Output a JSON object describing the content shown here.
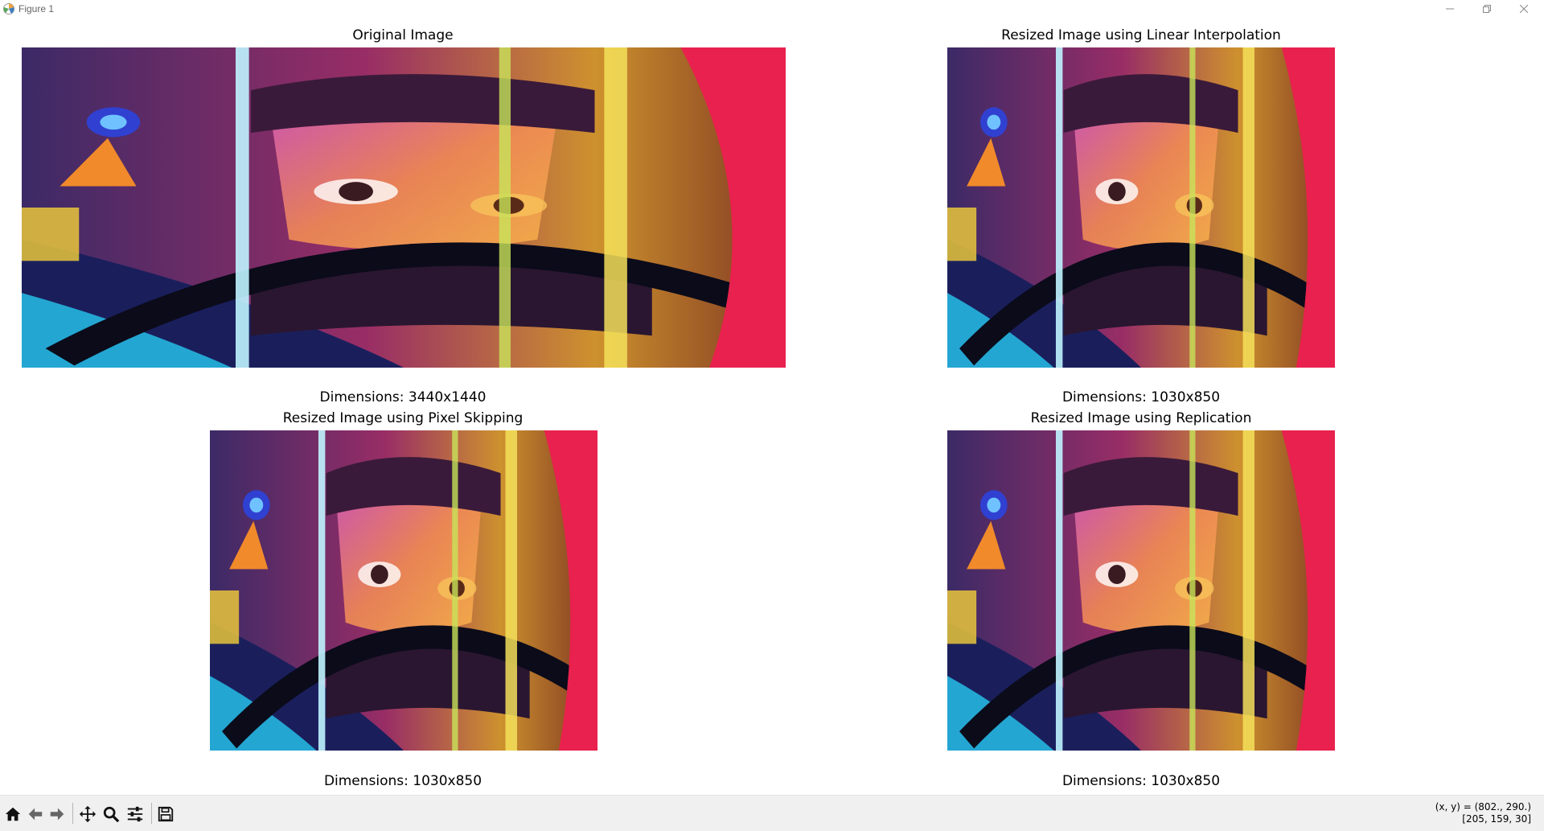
{
  "window": {
    "title": "Figure 1",
    "controls": [
      "minimize-icon",
      "restore-icon",
      "close-icon"
    ]
  },
  "subplots": [
    {
      "title": "Original Image",
      "xlabel": "Dimensions: 3440x1440"
    },
    {
      "title": "Resized Image using Linear Interpolation",
      "xlabel": "Dimensions: 1030x850"
    },
    {
      "title": "Resized Image using Pixel Skipping",
      "xlabel": "Dimensions: 1030x850"
    },
    {
      "title": "Resized Image using Replication",
      "xlabel": "Dimensions: 1030x850"
    }
  ],
  "toolbar": {
    "buttons": [
      "home-icon",
      "back-icon",
      "forward-icon",
      "pan-icon",
      "zoom-icon",
      "configure-subplots-icon",
      "save-icon"
    ],
    "coords_line1": "(x, y) = (802., 290.)",
    "coords_line2": "[205, 159, 30]"
  },
  "colors": {
    "toolbar_bg": "#f0f0f0",
    "image_bg": "#e8214e",
    "visor_dark": "#2a1630",
    "cyan": "#27c8f0",
    "yellow": "#f4e15a",
    "orange": "#f08a2a"
  }
}
